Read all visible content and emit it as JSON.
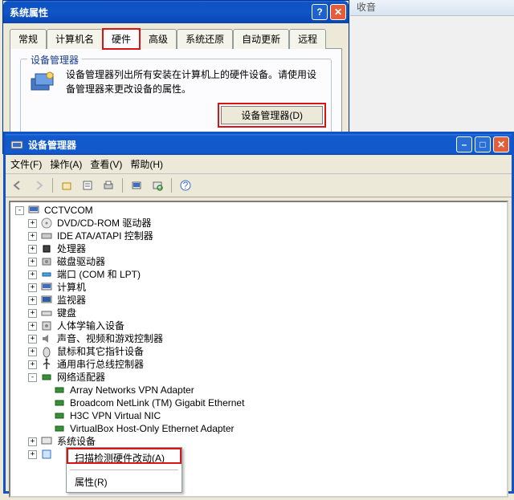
{
  "sysprops": {
    "title": "系统属性",
    "help_label": "?",
    "close_label": "✕",
    "tabs": [
      "常规",
      "计算机名",
      "硬件",
      "高级",
      "系统还原",
      "自动更新",
      "远程"
    ],
    "active_tab_index": 2,
    "device_manager_group": {
      "legend": "设备管理器",
      "description": "设备管理器列出所有安装在计算机上的硬件设备。请使用设备管理器来更改设备的属性。",
      "button_label": "设备管理器(D)"
    }
  },
  "devmgr": {
    "title": "设备管理器",
    "min_label": "–",
    "max_label": "□",
    "close_label": "✕",
    "menu": {
      "file": "文件(F)",
      "action": "操作(A)",
      "view": "查看(V)",
      "help": "帮助(H)"
    },
    "toolbar_icons": [
      "back-icon",
      "fwd-icon",
      "up-icon",
      "properties-icon",
      "print-icon",
      "refresh-icon",
      "scan-icon",
      "help-icon"
    ],
    "root": "CCTVCOM",
    "categories": [
      {
        "label": "DVD/CD-ROM 驱动器",
        "icon": "disc-icon",
        "expandable": true
      },
      {
        "label": "IDE ATA/ATAPI 控制器",
        "icon": "ide-icon",
        "expandable": true
      },
      {
        "label": "处理器",
        "icon": "cpu-icon",
        "expandable": true
      },
      {
        "label": "磁盘驱动器",
        "icon": "disk-icon",
        "expandable": true
      },
      {
        "label": "端口 (COM 和 LPT)",
        "icon": "port-icon",
        "expandable": true
      },
      {
        "label": "计算机",
        "icon": "computer-icon",
        "expandable": true
      },
      {
        "label": "监视器",
        "icon": "monitor-icon",
        "expandable": true
      },
      {
        "label": "键盘",
        "icon": "keyboard-icon",
        "expandable": true
      },
      {
        "label": "人体学输入设备",
        "icon": "hid-icon",
        "expandable": true
      },
      {
        "label": "声音、视频和游戏控制器",
        "icon": "sound-icon",
        "expandable": true
      },
      {
        "label": "鼠标和其它指针设备",
        "icon": "mouse-icon",
        "expandable": true
      },
      {
        "label": "通用串行总线控制器",
        "icon": "usb-icon",
        "expandable": true
      },
      {
        "label": "网络适配器",
        "icon": "network-icon",
        "expandable": true,
        "expanded": true,
        "children": [
          {
            "label": "Array Networks VPN Adapter",
            "icon": "nic-icon"
          },
          {
            "label": "Broadcom NetLink (TM) Gigabit Ethernet",
            "icon": "nic-icon"
          },
          {
            "label": "H3C VPN Virtual NIC",
            "icon": "nic-icon"
          },
          {
            "label": "VirtualBox Host-Only Ethernet Adapter",
            "icon": "nic-icon"
          }
        ]
      },
      {
        "label": "系统设备",
        "icon": "system-icon",
        "expandable": true
      },
      {
        "label": "",
        "icon": "unknown-icon",
        "expandable": true,
        "selected": true
      }
    ]
  },
  "context_menu": {
    "scan": "扫描检测硬件改动(A)",
    "properties": "属性(R)"
  },
  "bg": {
    "hint": "收音"
  }
}
